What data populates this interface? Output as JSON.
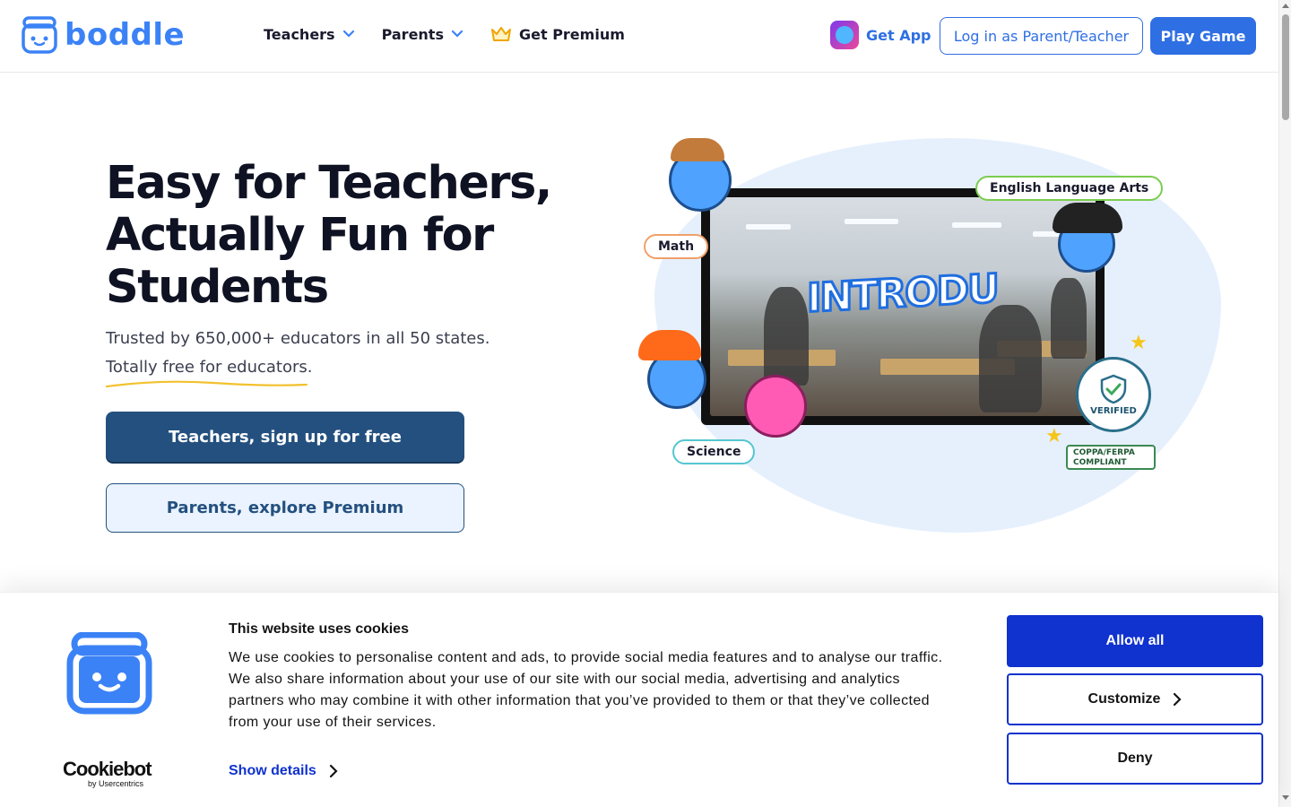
{
  "header": {
    "brand": "boddle",
    "nav": [
      {
        "label": "Teachers"
      },
      {
        "label": "Parents"
      }
    ],
    "premium_label": "Get Premium",
    "get_app_label": "Get App",
    "login_label": "Log in as Parent/Teacher",
    "play_label": "Play Game"
  },
  "hero": {
    "title_line1": "Easy for Teachers,",
    "title_line2": "Actually Fun for",
    "title_line3": "Students",
    "subtitle": "Trusted by 650,000+ educators in all 50 states.",
    "subtitle2": "Totally free for educators.",
    "cta_teachers": "Teachers, sign up for free",
    "cta_parents": "Parents, explore Premium"
  },
  "illustration": {
    "tag_ela": "English Language Arts",
    "tag_math": "Math",
    "tag_science": "Science",
    "screen_text": "INTRODU",
    "badge_verified_text": "VERIFIED",
    "badge_coppa_line1": "COPPA/FERPA",
    "badge_coppa_line2": "COMPLIANT"
  },
  "cookie_banner": {
    "title": "This website uses cookies",
    "body": "We use cookies to personalise content and ads, to provide social media features and to analyse our traffic. We also share information about your use of our site with our social media, advertising and analytics partners who may combine it with other information that you’ve provided to them or that they’ve collected from your use of their services.",
    "show_details": "Show details",
    "allow_all": "Allow all",
    "customize": "Customize",
    "deny": "Deny",
    "provider_name": "Cookiebot",
    "provider_sub": "by Usercentrics"
  },
  "colors": {
    "brand_blue": "#3b82f6",
    "primary_button": "#2f6fe4",
    "hero_dark_button": "#24507f",
    "cookie_blue": "#1032cf"
  },
  "icons": [
    "boddle-logo-icon",
    "chevron-down-icon",
    "crown-icon",
    "app-icon",
    "chevron-right-icon",
    "shield-check-icon",
    "checkmark-icon",
    "star-icon"
  ]
}
